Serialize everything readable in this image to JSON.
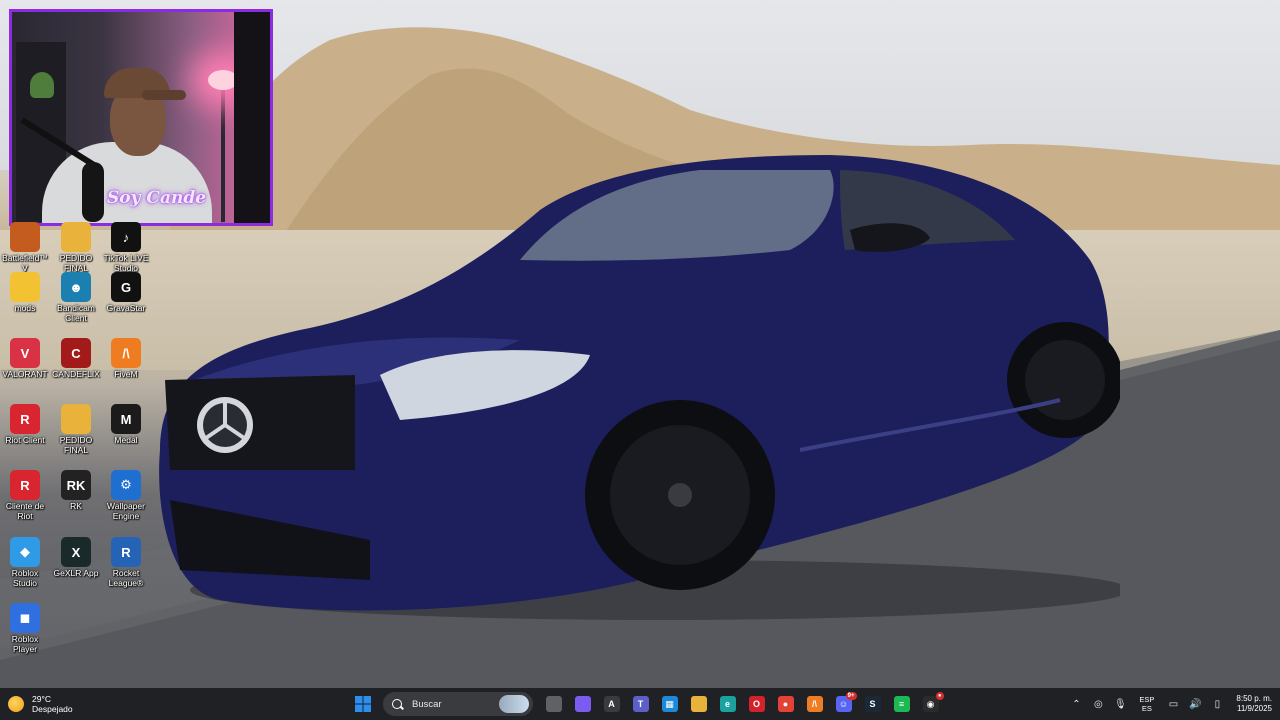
{
  "wallpaper": {
    "description_color_accent": "#1c1f5c"
  },
  "webcam": {
    "overlay_text": "Soy Cande"
  },
  "desktop_icons": [
    {
      "label": "Battlefield™ V",
      "icon": "battlefield-icon",
      "color": "#c45b1f",
      "glyph": ""
    },
    {
      "label": "PEDIDO FINAL",
      "icon": "folder-icon",
      "color": "#e9b23a",
      "glyph": ""
    },
    {
      "label": "TikTok LIVE Studio",
      "icon": "tiktok-icon",
      "color": "#111111",
      "glyph": "♪"
    },
    {
      "label": "mods",
      "icon": "folder-icon",
      "color": "#f2c232",
      "glyph": ""
    },
    {
      "label": "Bandicam Client",
      "icon": "bandicam-icon",
      "color": "#1b7fb0",
      "glyph": "☻"
    },
    {
      "label": "GravaStar",
      "icon": "gravastar-icon",
      "color": "#111111",
      "glyph": "G"
    },
    {
      "label": "VALORANT",
      "icon": "valorant-icon",
      "color": "#d83244",
      "glyph": "V"
    },
    {
      "label": "CANDEFLIX",
      "icon": "candeflix-icon",
      "color": "#a21a1a",
      "glyph": "C"
    },
    {
      "label": "FiveM",
      "icon": "fivem-icon",
      "color": "#f07c22",
      "glyph": "/\\"
    },
    {
      "label": "Riot Client",
      "icon": "riot-icon",
      "color": "#d8252f",
      "glyph": "R"
    },
    {
      "label": "PEDIDO FINAL",
      "icon": "folder-icon",
      "color": "#e9b23a",
      "glyph": ""
    },
    {
      "label": "Medal",
      "icon": "medal-icon",
      "color": "#1b1b1b",
      "glyph": "M"
    },
    {
      "label": "Cliente de Riot",
      "icon": "riot-icon",
      "color": "#d8252f",
      "glyph": "R"
    },
    {
      "label": "RK",
      "icon": "rk-icon",
      "color": "#222222",
      "glyph": "RK"
    },
    {
      "label": "Wallpaper Engine",
      "icon": "wallpaper-engine-icon",
      "color": "#1f6fd1",
      "glyph": "⚙"
    },
    {
      "label": "Roblox Studio",
      "icon": "roblox-studio-icon",
      "color": "#2f9be6",
      "glyph": "◆"
    },
    {
      "label": "GeXLR App",
      "icon": "gexlr-icon",
      "color": "#1a2a2a",
      "glyph": "X"
    },
    {
      "label": "Rocket League®",
      "icon": "rocket-league-icon",
      "color": "#2463b5",
      "glyph": "R"
    },
    {
      "label": "Roblox Player",
      "icon": "roblox-icon",
      "color": "#2f6fe0",
      "glyph": "◼"
    }
  ],
  "taskbar": {
    "weather_temp": "29°C",
    "weather_desc": "Despejado",
    "search_placeholder": "Buscar",
    "apps": [
      {
        "icon": "windows-start-icon",
        "color": "#2b8ef0",
        "glyph": ""
      },
      {
        "icon": "task-view-icon",
        "color": "#5e6166",
        "glyph": ""
      },
      {
        "icon": "copilot-icon",
        "color": "#7a5cf0",
        "glyph": ""
      },
      {
        "icon": "widgets-icon",
        "color": "#3a3b3e",
        "glyph": "A"
      },
      {
        "icon": "teams-icon",
        "color": "#5b5fc7",
        "glyph": "T"
      },
      {
        "icon": "microsoft-store-icon",
        "color": "#1c8ad8",
        "glyph": "▦"
      },
      {
        "icon": "file-explorer-icon",
        "color": "#e9b23a",
        "glyph": ""
      },
      {
        "icon": "edge-icon",
        "color": "#1aa29e",
        "glyph": "e"
      },
      {
        "icon": "opera-icon",
        "color": "#d3222c",
        "glyph": "O"
      },
      {
        "icon": "chrome-icon",
        "color": "#e24335",
        "glyph": "●"
      },
      {
        "icon": "fivem-taskbar-icon",
        "color": "#f07c22",
        "glyph": "/\\"
      },
      {
        "icon": "discord-icon",
        "color": "#5865f2",
        "glyph": "☺",
        "badge": "9+"
      },
      {
        "icon": "steam-icon",
        "color": "#1b2838",
        "glyph": "S"
      },
      {
        "icon": "spotify-icon",
        "color": "#1db954",
        "glyph": "≡"
      },
      {
        "icon": "obs-icon",
        "color": "#2b2b2b",
        "glyph": "◉",
        "badge": "●"
      }
    ],
    "language_line1": "ESP",
    "language_line2": "ES",
    "time": "8:50 p. m.",
    "date": "11/9/2025"
  }
}
